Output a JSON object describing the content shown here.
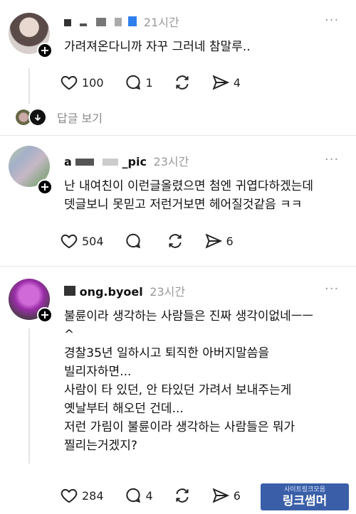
{
  "comments": [
    {
      "username": "",
      "time": "21시간",
      "body": "가려져온다니까 자꾸 그러네 참말루..",
      "likes": "100",
      "replies": "1",
      "reposts": "",
      "shares": "4"
    },
    {
      "username": "_pic",
      "time": "23시간",
      "body": "난 내여친이 이런글올렸으면 첨엔 귀엽다하겠는데\n뎃글보니 못믿고 저런거보면 헤어질것같음 ㅋㅋ",
      "likes": "504",
      "replies": "",
      "reposts": "",
      "shares": "6"
    },
    {
      "username": "ong.byoel",
      "time": "23시간",
      "body": "불륜이라 생각하는 사람들은 진짜 생각이없네ㅡㅡ\n^\n경찰35년 일하시고 퇴직한 아버지말씀을\n빌리자하면...\n사람이 타 있던, 안 타있던 가려서 보내주는게\n옛날부터 해오던 건데...\n저런 가림이 불륜이라 생각하는 사람들은 뭐가\n찔리는거겠지?",
      "likes": "284",
      "replies": "4",
      "reposts": "",
      "shares": "6"
    }
  ],
  "view_replies_label": "답글 보기",
  "more_symbol": "···",
  "watermark": {
    "line1": "사이트링크모음",
    "line2": "링크썸머"
  },
  "colors": {
    "plus_bg": "#000000",
    "time_gray": "#999999",
    "watermark_bg": "#3a5fa8"
  }
}
